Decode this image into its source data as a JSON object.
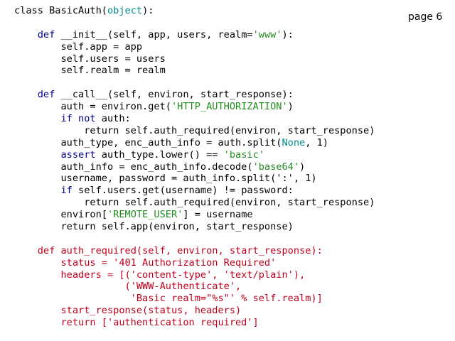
{
  "page_label": "page 6",
  "colors": {
    "text": "#000000",
    "keyword": "#00008b",
    "string": "#228b22",
    "builtin": "#008b8b",
    "highlight_block": "#c0001a"
  },
  "code_lines": [
    [
      [
        "",
        "class"
      ],
      [
        "",
        " BasicAuth("
      ],
      [
        "builtin",
        "object"
      ],
      [
        "",
        "):"
      ]
    ],
    [],
    [
      [
        "",
        "    "
      ],
      [
        "kw",
        "def"
      ],
      [
        "",
        " __init__(self, app, users, realm="
      ],
      [
        "str",
        "'www'"
      ],
      [
        "",
        "):"
      ]
    ],
    [
      [
        "",
        "        self.app = app"
      ]
    ],
    [
      [
        "",
        "        self.users = users"
      ]
    ],
    [
      [
        "",
        "        self.realm = realm"
      ]
    ],
    [],
    [
      [
        "",
        "    "
      ],
      [
        "kw",
        "def"
      ],
      [
        "",
        " __call__(self, environ, start_response):"
      ]
    ],
    [
      [
        "",
        "        auth = environ.get("
      ],
      [
        "str",
        "'HTTP_AUTHORIZATION'"
      ],
      [
        "",
        ")"
      ]
    ],
    [
      [
        "",
        "        "
      ],
      [
        "kw",
        "if not"
      ],
      [
        "",
        " auth:"
      ]
    ],
    [
      [
        "",
        "            return self.auth_required(environ, start_response)"
      ]
    ],
    [
      [
        "",
        "        auth_type, enc_auth_info = auth.split("
      ],
      [
        "builtin",
        "None"
      ],
      [
        "",
        ", 1)"
      ]
    ],
    [
      [
        "",
        "        "
      ],
      [
        "kw",
        "assert"
      ],
      [
        "",
        " auth_type.lower() == "
      ],
      [
        "str",
        "'basic'"
      ]
    ],
    [
      [
        "",
        "        auth_info = enc_auth_info.decode("
      ],
      [
        "str",
        "'base64'"
      ],
      [
        "",
        ")"
      ]
    ],
    [
      [
        "",
        "        username, password = auth_info.split(':', 1)"
      ]
    ],
    [
      [
        "",
        "        "
      ],
      [
        "kw",
        "if"
      ],
      [
        "",
        " self.users.get(username) != password:"
      ]
    ],
    [
      [
        "",
        "            return self.auth_required(environ, start_response)"
      ]
    ],
    [
      [
        "",
        "        environ["
      ],
      [
        "str",
        "'REMOTE_USER'"
      ],
      [
        "",
        "] = username"
      ]
    ],
    [
      [
        "",
        "        return self.app(environ, start_response)"
      ]
    ],
    [],
    [
      [
        "",
        "    "
      ],
      [
        "red",
        "def auth_required(self, environ, start_response):"
      ]
    ],
    [
      [
        "red",
        "        status = '401 Authorization Required'"
      ]
    ],
    [
      [
        "red",
        "        headers = [('content-type', 'text/plain'),"
      ]
    ],
    [
      [
        "red",
        "                   ('WWW-Authenticate',"
      ]
    ],
    [
      [
        "red",
        "                    'Basic realm=\"%s\"' % self.realm)]"
      ]
    ],
    [
      [
        "red",
        "        start_response(status, headers)"
      ]
    ],
    [
      [
        "red",
        "        return ['authentication required']"
      ]
    ]
  ]
}
